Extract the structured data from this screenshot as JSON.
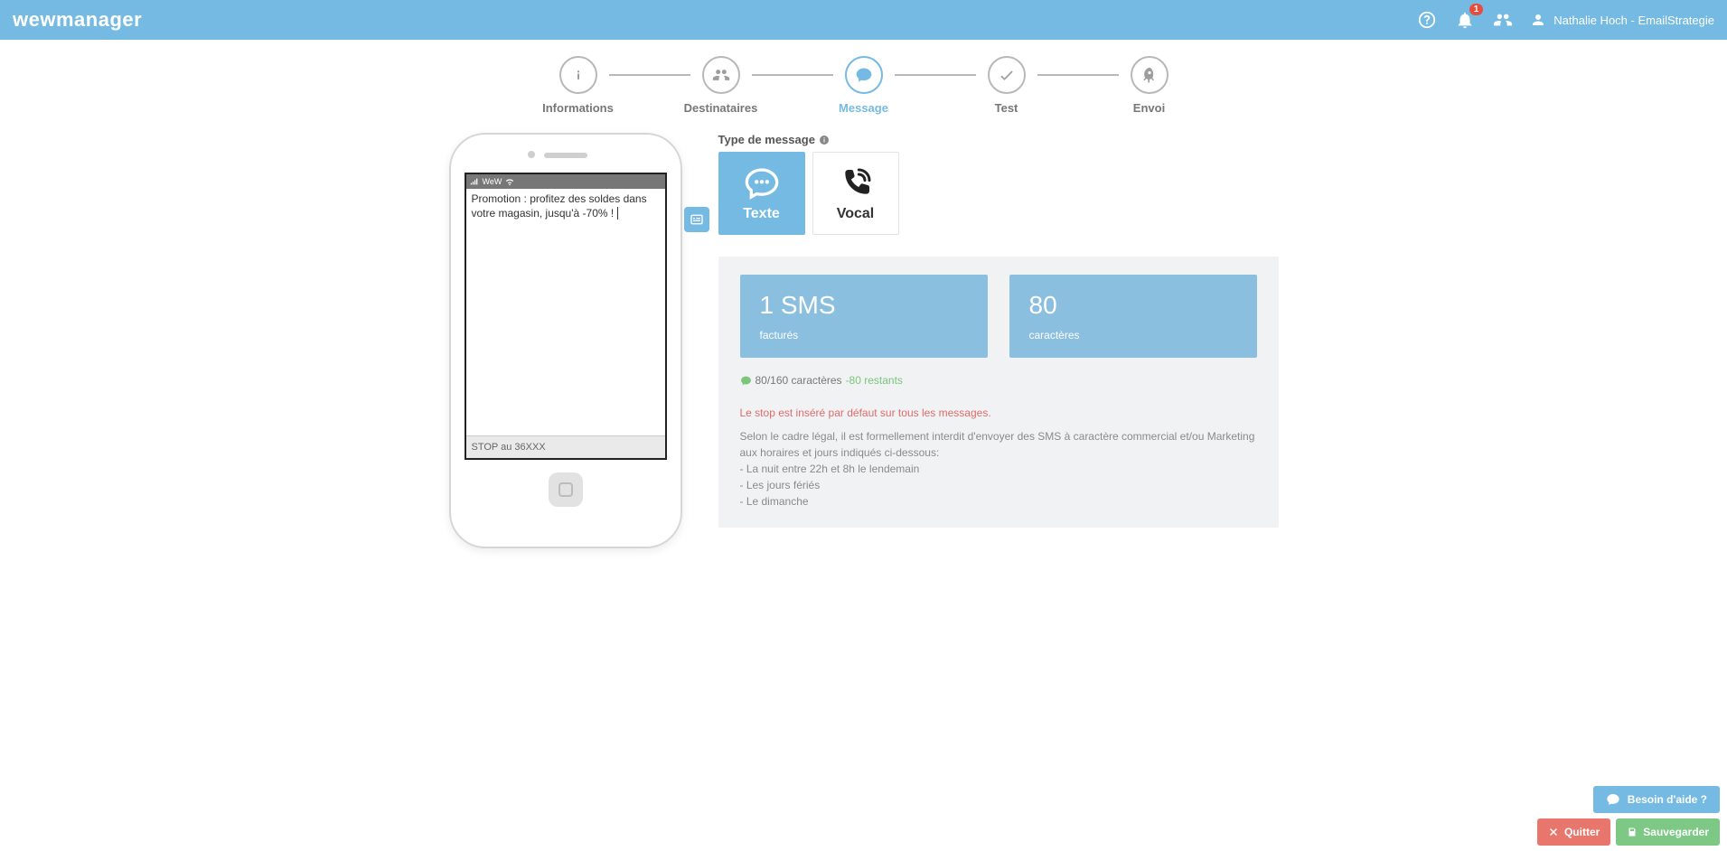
{
  "header": {
    "logo_primary": "wew",
    "logo_secondary": "manager",
    "notification_count": "1",
    "user_name": "Nathalie Hoch - EmailStrategie"
  },
  "stepper": {
    "steps": [
      {
        "label": "Informations",
        "icon": "info",
        "active": false
      },
      {
        "label": "Destinataires",
        "icon": "users",
        "active": false
      },
      {
        "label": "Message",
        "icon": "message",
        "active": true
      },
      {
        "label": "Test",
        "icon": "check",
        "active": false
      },
      {
        "label": "Envoi",
        "icon": "rocket",
        "active": false
      }
    ]
  },
  "phone": {
    "carrier": "WeW",
    "message_text": "Promotion : profitez des soldes dans votre magasin, jusqu'à -70% !",
    "stop_text": "STOP au 36XXX"
  },
  "config": {
    "message_type_label": "Type de message",
    "types": {
      "texte": "Texte",
      "vocal": "Vocal"
    },
    "stats": {
      "sms_count": "1 SMS",
      "sms_sub": "facturés",
      "char_count": "80",
      "char_sub": "caractères"
    },
    "char_line": {
      "main": "80/160 caractères",
      "rest": "-80 restants"
    },
    "warning": "Le stop est inséré par défaut sur tous les messages.",
    "legal": {
      "intro": "Selon le cadre légal, il est formellement interdit d'envoyer des SMS à caractère commercial et/ou Marketing aux horaires et jours indiqués ci-dessous:",
      "line1": "- La nuit entre 22h et 8h le lendemain",
      "line2": "- Les jours fériés",
      "line3": "- Le dimanche"
    }
  },
  "footer": {
    "help": "Besoin d'aide ?",
    "quit": "Quitter",
    "save": "Sauvegarder"
  }
}
